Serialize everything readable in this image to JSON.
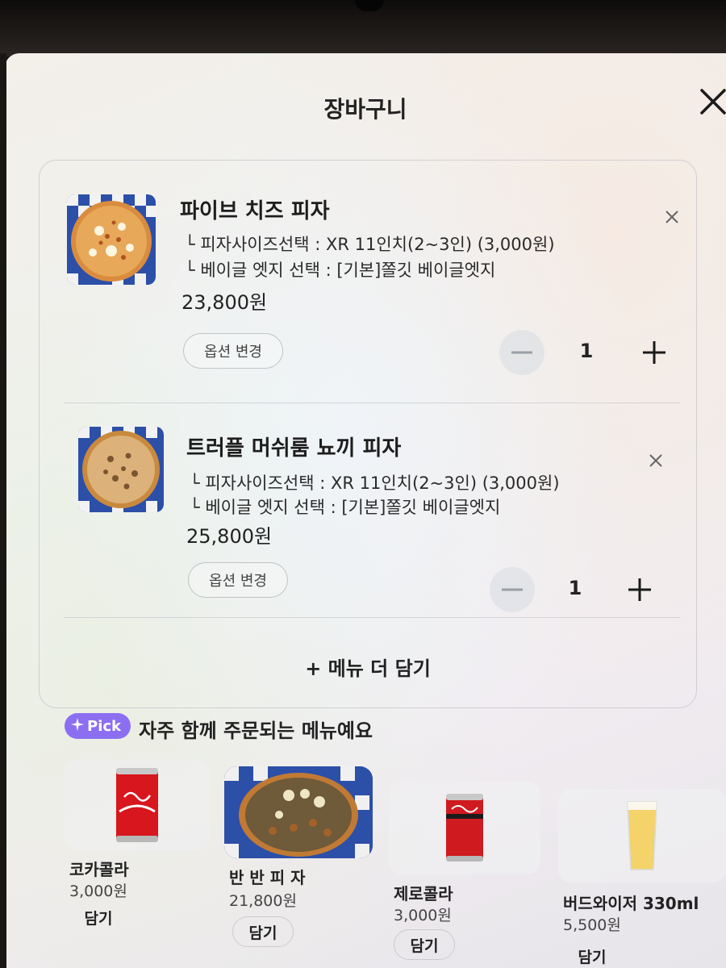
{
  "sheet": {
    "title": "장바구니",
    "close_icon": "close-icon"
  },
  "cart_items": [
    {
      "name": "파이브 치즈 피자",
      "options": [
        "└ 피자사이즈선택 : XR 11인치(2~3인) (3,000원)",
        "└ 베이글 엣지 선택 : [기본]쫄깃 베이글엣지"
      ],
      "price": "23,800원",
      "option_change_label": "옵션 변경",
      "quantity": "1"
    },
    {
      "name": "트러플 머쉬룸 뇨끼 피자",
      "options": [
        "└ 피자사이즈선택 : XR 11인치(2~3인) (3,000원)",
        "└ 베이글 엣지 선택 : [기본]쫄깃 베이글엣지"
      ],
      "price": "25,800원",
      "option_change_label": "옵션 변경",
      "quantity": "1"
    }
  ],
  "add_more_label": "+ 메뉴 더 담기",
  "recommendations": {
    "badge": "Pick",
    "badge_icon": "sparkle-icon",
    "title": "자주 함께 주문되는 메뉴예요",
    "items": [
      {
        "name": "코카콜라",
        "price": "3,000원",
        "add_label": "담기",
        "image": "coca-cola-can"
      },
      {
        "name": "반 반 피 자",
        "price": "21,800원",
        "add_label": "담기",
        "image": "half-half-pizza"
      },
      {
        "name": "제로콜라",
        "price": "3,000원",
        "add_label": "담기",
        "image": "zero-cola-can"
      },
      {
        "name": "버드와이저 330ml",
        "price": "5,500원",
        "add_label": "담기",
        "image": "beer-glass"
      }
    ]
  },
  "colors": {
    "pick_badge": "#8b6ff0",
    "text": "#222222",
    "coke_red": "#d7161d"
  }
}
